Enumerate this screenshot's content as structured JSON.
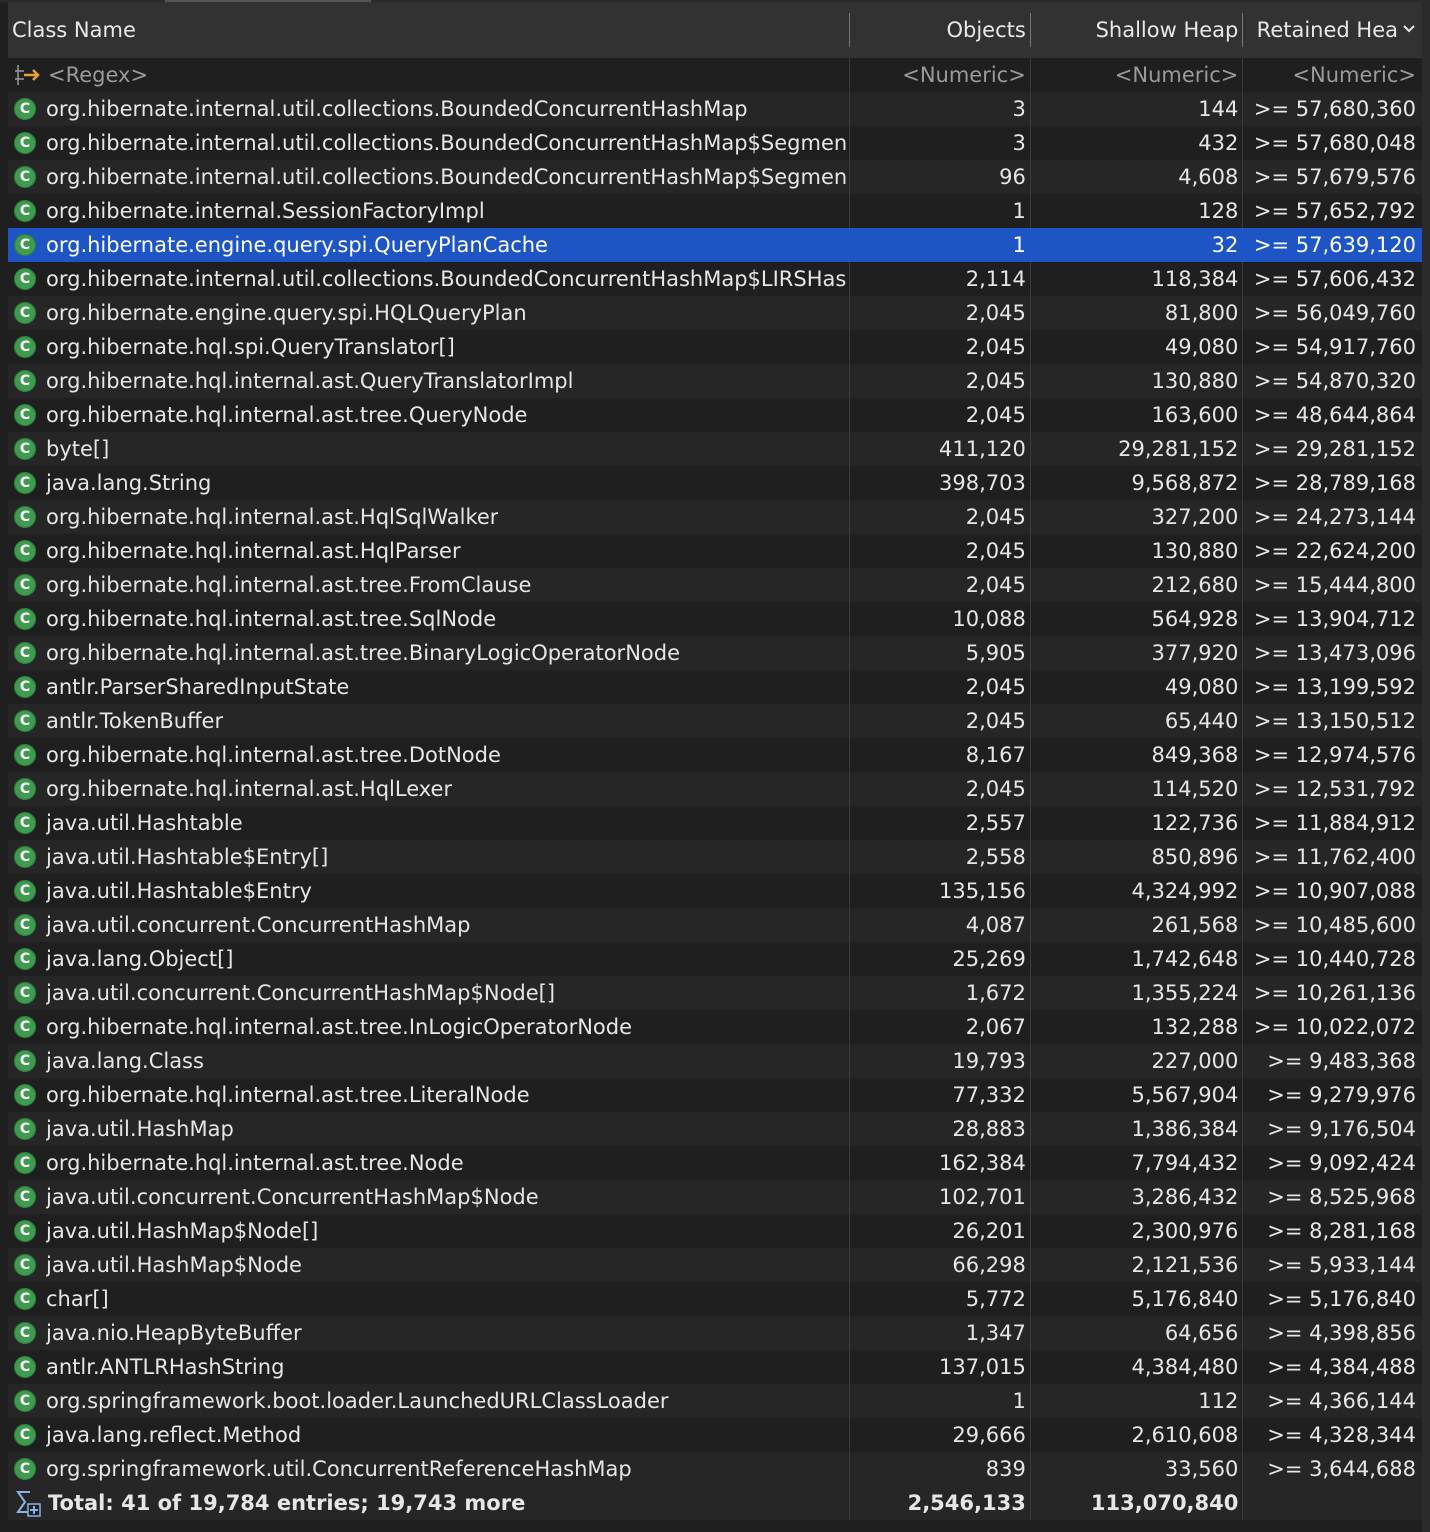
{
  "columns": {
    "name": "Class Name",
    "objects": "Objects",
    "shallow": "Shallow Heap",
    "retained": "Retained Hea"
  },
  "filter": {
    "name": "<Regex>",
    "objects": "<Numeric>",
    "shallow": "<Numeric>",
    "retained": "<Numeric>"
  },
  "selected_index": 4,
  "rows": [
    {
      "name": "org.hibernate.internal.util.collections.BoundedConcurrentHashMap",
      "objects": "3",
      "shallow": "144",
      "retained": ">= 57,680,360"
    },
    {
      "name": "org.hibernate.internal.util.collections.BoundedConcurrentHashMap$Segmen",
      "objects": "3",
      "shallow": "432",
      "retained": ">= 57,680,048"
    },
    {
      "name": "org.hibernate.internal.util.collections.BoundedConcurrentHashMap$Segmen",
      "objects": "96",
      "shallow": "4,608",
      "retained": ">= 57,679,576"
    },
    {
      "name": "org.hibernate.internal.SessionFactoryImpl",
      "objects": "1",
      "shallow": "128",
      "retained": ">= 57,652,792"
    },
    {
      "name": "org.hibernate.engine.query.spi.QueryPlanCache",
      "objects": "1",
      "shallow": "32",
      "retained": ">= 57,639,120"
    },
    {
      "name": "org.hibernate.internal.util.collections.BoundedConcurrentHashMap$LIRSHas",
      "objects": "2,114",
      "shallow": "118,384",
      "retained": ">= 57,606,432"
    },
    {
      "name": "org.hibernate.engine.query.spi.HQLQueryPlan",
      "objects": "2,045",
      "shallow": "81,800",
      "retained": ">= 56,049,760"
    },
    {
      "name": "org.hibernate.hql.spi.QueryTranslator[]",
      "objects": "2,045",
      "shallow": "49,080",
      "retained": ">= 54,917,760"
    },
    {
      "name": "org.hibernate.hql.internal.ast.QueryTranslatorImpl",
      "objects": "2,045",
      "shallow": "130,880",
      "retained": ">= 54,870,320"
    },
    {
      "name": "org.hibernate.hql.internal.ast.tree.QueryNode",
      "objects": "2,045",
      "shallow": "163,600",
      "retained": ">= 48,644,864"
    },
    {
      "name": "byte[]",
      "objects": "411,120",
      "shallow": "29,281,152",
      "retained": ">= 29,281,152"
    },
    {
      "name": "java.lang.String",
      "objects": "398,703",
      "shallow": "9,568,872",
      "retained": ">= 28,789,168"
    },
    {
      "name": "org.hibernate.hql.internal.ast.HqlSqlWalker",
      "objects": "2,045",
      "shallow": "327,200",
      "retained": ">= 24,273,144"
    },
    {
      "name": "org.hibernate.hql.internal.ast.HqlParser",
      "objects": "2,045",
      "shallow": "130,880",
      "retained": ">= 22,624,200"
    },
    {
      "name": "org.hibernate.hql.internal.ast.tree.FromClause",
      "objects": "2,045",
      "shallow": "212,680",
      "retained": ">= 15,444,800"
    },
    {
      "name": "org.hibernate.hql.internal.ast.tree.SqlNode",
      "objects": "10,088",
      "shallow": "564,928",
      "retained": ">= 13,904,712"
    },
    {
      "name": "org.hibernate.hql.internal.ast.tree.BinaryLogicOperatorNode",
      "objects": "5,905",
      "shallow": "377,920",
      "retained": ">= 13,473,096"
    },
    {
      "name": "antlr.ParserSharedInputState",
      "objects": "2,045",
      "shallow": "49,080",
      "retained": ">= 13,199,592"
    },
    {
      "name": "antlr.TokenBuffer",
      "objects": "2,045",
      "shallow": "65,440",
      "retained": ">= 13,150,512"
    },
    {
      "name": "org.hibernate.hql.internal.ast.tree.DotNode",
      "objects": "8,167",
      "shallow": "849,368",
      "retained": ">= 12,974,576"
    },
    {
      "name": "org.hibernate.hql.internal.ast.HqlLexer",
      "objects": "2,045",
      "shallow": "114,520",
      "retained": ">= 12,531,792"
    },
    {
      "name": "java.util.Hashtable",
      "objects": "2,557",
      "shallow": "122,736",
      "retained": ">= 11,884,912"
    },
    {
      "name": "java.util.Hashtable$Entry[]",
      "objects": "2,558",
      "shallow": "850,896",
      "retained": ">= 11,762,400"
    },
    {
      "name": "java.util.Hashtable$Entry",
      "objects": "135,156",
      "shallow": "4,324,992",
      "retained": ">= 10,907,088"
    },
    {
      "name": "java.util.concurrent.ConcurrentHashMap",
      "objects": "4,087",
      "shallow": "261,568",
      "retained": ">= 10,485,600"
    },
    {
      "name": "java.lang.Object[]",
      "objects": "25,269",
      "shallow": "1,742,648",
      "retained": ">= 10,440,728"
    },
    {
      "name": "java.util.concurrent.ConcurrentHashMap$Node[]",
      "objects": "1,672",
      "shallow": "1,355,224",
      "retained": ">= 10,261,136"
    },
    {
      "name": "org.hibernate.hql.internal.ast.tree.InLogicOperatorNode",
      "objects": "2,067",
      "shallow": "132,288",
      "retained": ">= 10,022,072"
    },
    {
      "name": "java.lang.Class",
      "objects": "19,793",
      "shallow": "227,000",
      "retained": ">= 9,483,368"
    },
    {
      "name": "org.hibernate.hql.internal.ast.tree.LiteralNode",
      "objects": "77,332",
      "shallow": "5,567,904",
      "retained": ">= 9,279,976"
    },
    {
      "name": "java.util.HashMap",
      "objects": "28,883",
      "shallow": "1,386,384",
      "retained": ">= 9,176,504"
    },
    {
      "name": "org.hibernate.hql.internal.ast.tree.Node",
      "objects": "162,384",
      "shallow": "7,794,432",
      "retained": ">= 9,092,424"
    },
    {
      "name": "java.util.concurrent.ConcurrentHashMap$Node",
      "objects": "102,701",
      "shallow": "3,286,432",
      "retained": ">= 8,525,968"
    },
    {
      "name": "java.util.HashMap$Node[]",
      "objects": "26,201",
      "shallow": "2,300,976",
      "retained": ">= 8,281,168"
    },
    {
      "name": "java.util.HashMap$Node",
      "objects": "66,298",
      "shallow": "2,121,536",
      "retained": ">= 5,933,144"
    },
    {
      "name": "char[]",
      "objects": "5,772",
      "shallow": "5,176,840",
      "retained": ">= 5,176,840"
    },
    {
      "name": "java.nio.HeapByteBuffer",
      "objects": "1,347",
      "shallow": "64,656",
      "retained": ">= 4,398,856"
    },
    {
      "name": "antlr.ANTLRHashString",
      "objects": "137,015",
      "shallow": "4,384,480",
      "retained": ">= 4,384,488"
    },
    {
      "name": "org.springframework.boot.loader.LaunchedURLClassLoader",
      "objects": "1",
      "shallow": "112",
      "retained": ">= 4,366,144"
    },
    {
      "name": "java.lang.reflect.Method",
      "objects": "29,666",
      "shallow": "2,610,608",
      "retained": ">= 4,328,344"
    },
    {
      "name": "org.springframework.util.ConcurrentReferenceHashMap",
      "objects": "839",
      "shallow": "33,560",
      "retained": ">= 3,644,688"
    }
  ],
  "total": {
    "label": "Total: 41 of 19,784 entries; 19,743 more",
    "objects": "2,546,133",
    "shallow": "113,070,840",
    "retained": ""
  },
  "icons": {
    "class": "class-icon",
    "class_letter": "C",
    "regex": "regex-filter-icon",
    "total": "sum-icon",
    "sort": "chevron-down-icon"
  },
  "colors": {
    "selection": "#1d55c5",
    "class_icon": "#3f9b4f",
    "header_bg": "#323232"
  }
}
